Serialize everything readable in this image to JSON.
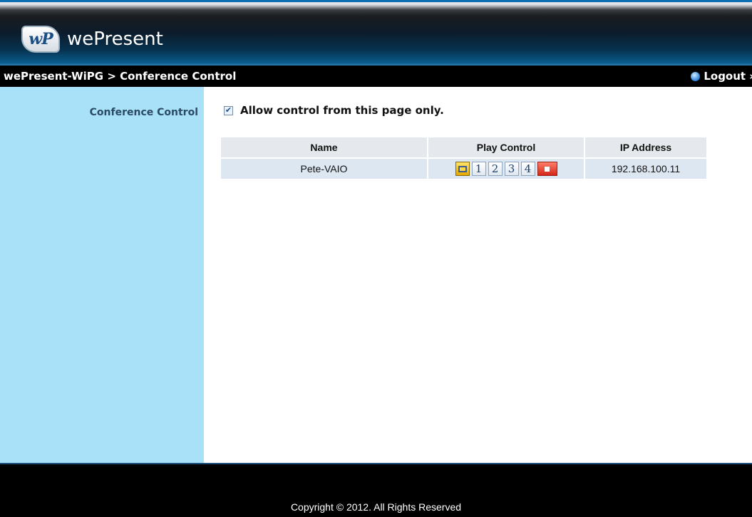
{
  "header": {
    "logo_badge": "wP",
    "logo_text": "wePresent"
  },
  "titlebar": {
    "breadcrumb": "wePresent-WiPG > Conference Control",
    "logout_label": "Logout »"
  },
  "sidebar": {
    "section_label": "Conference Control"
  },
  "main": {
    "allow_checkbox": {
      "checked": true,
      "label": "Allow control from this page only."
    },
    "table": {
      "headers": [
        "Name",
        "Play Control",
        "IP Address"
      ],
      "rows": [
        {
          "name": "Pete-VAIO",
          "play_control": {
            "fullscreen_icon": "fullscreen-icon",
            "split_buttons": [
              "1",
              "2",
              "3",
              "4"
            ],
            "stop_icon": "stop-icon"
          },
          "ip": "192.168.100.11"
        }
      ]
    }
  },
  "footer": {
    "copyright": "Copyright © 2012. All Rights Reserved"
  },
  "colors": {
    "sidebar_bg": "#a9e1f8",
    "titlebar_bg": "#000000",
    "header_accent": "#0a5b8c",
    "stop_button": "#d3261a",
    "fullscreen_button": "#e4a800"
  }
}
